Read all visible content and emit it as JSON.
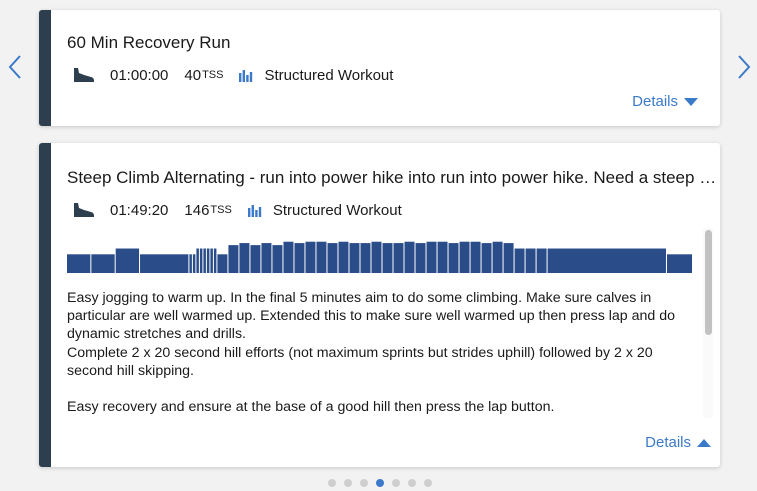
{
  "colors": {
    "accent": "#3b79c9",
    "card_stripe": "#2d3e4f",
    "graph_bar": "#2a4d8a",
    "icon": "#2d3e4f"
  },
  "nav": {
    "prev_icon": "chevron-left-icon",
    "next_icon": "chevron-right-icon"
  },
  "cards": [
    {
      "title": "60 Min Recovery Run",
      "duration": "01:00:00",
      "tss_value": "40",
      "tss_unit": "TSS",
      "type_label": "Structured Workout",
      "details_label": "Details",
      "expanded": false
    },
    {
      "title": "Steep Climb Alternating - run into power hike into run into power hike. Need a steep hill",
      "duration": "01:49:20",
      "tss_value": "146",
      "tss_unit": "TSS",
      "type_label": "Structured Workout",
      "details_label": "Details",
      "expanded": true,
      "description": [
        "Easy jogging to warm up. In the final 5 minutes aim to do some climbing. Make sure calves in particular are well warmed up. Extended this to make sure well warmed up then press lap and do dynamic stretches and drills.",
        "Complete 2 x 20 second hill efforts (not maximum sprints but strides uphill) followed by 2 x 20 second hill skipping.",
        "Easy recovery and ensure at the base of a good hill then press the lap button."
      ],
      "workout_intensities": [
        0.55,
        0.55,
        0.72,
        0.55,
        0.55,
        0.55,
        0.72,
        0.72,
        0.72,
        0.72,
        0.72,
        0.72,
        0.55,
        0.82,
        0.88,
        0.82,
        0.88,
        0.82,
        0.92,
        0.88,
        0.92,
        0.92,
        0.88,
        0.92,
        0.88,
        0.88,
        0.92,
        0.88,
        0.88,
        0.92,
        0.88,
        0.92,
        0.92,
        0.88,
        0.92,
        0.92,
        0.88,
        0.92,
        0.88,
        0.72,
        0.72,
        0.72,
        0.72,
        0.55
      ]
    }
  ],
  "pager": {
    "count": 7,
    "active_index": 3
  }
}
